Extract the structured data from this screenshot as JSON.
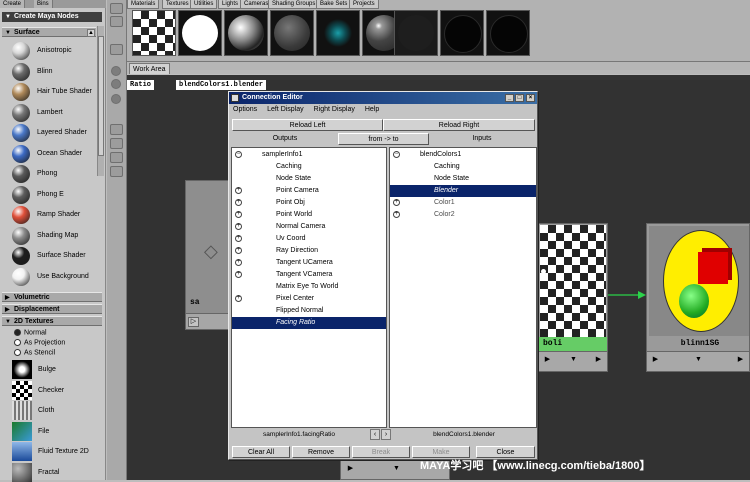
{
  "create_panel": {
    "top_tabs": [
      "Create",
      "Bins"
    ],
    "title": "Create Maya Nodes",
    "surface_header": "Surface",
    "shaders": [
      {
        "label": "Anisotropic",
        "icon": "anisotropic-shader-icon",
        "color": "#d7d7d7"
      },
      {
        "label": "Blinn",
        "icon": "blinn-shader-icon",
        "color": "#6b6b6b"
      },
      {
        "label": "Hair Tube Shader",
        "icon": "hair-tube-shader-icon",
        "color": "#b08a5a"
      },
      {
        "label": "Lambert",
        "icon": "lambert-shader-icon",
        "color": "#777777"
      },
      {
        "label": "Layered Shader",
        "icon": "layered-shader-icon",
        "color": "#4a78c8"
      },
      {
        "label": "Ocean Shader",
        "icon": "ocean-shader-icon",
        "color": "#3c6ac4"
      },
      {
        "label": "Phong",
        "icon": "phong-shader-icon",
        "color": "#5a5a5a"
      },
      {
        "label": "Phong E",
        "icon": "phong-e-shader-icon",
        "color": "#5e5e5e"
      },
      {
        "label": "Ramp Shader",
        "icon": "ramp-shader-icon",
        "color": "#e0503a"
      },
      {
        "label": "Shading Map",
        "icon": "shading-map-icon",
        "color": "#8c8c8c"
      },
      {
        "label": "Surface Shader",
        "icon": "surface-shader-icon",
        "color": "#1e1e1e"
      },
      {
        "label": "Use Background",
        "icon": "use-background-icon",
        "color": "#f2f2f2"
      }
    ],
    "sections": [
      "Volumetric",
      "Displacement",
      "2D Textures"
    ],
    "radio_options": [
      {
        "label": "Normal",
        "selected": true
      },
      {
        "label": "As Projection",
        "selected": false
      },
      {
        "label": "As Stencil",
        "selected": false
      }
    ],
    "textures": [
      {
        "label": "Bulge",
        "icon": "bulge-texture-icon"
      },
      {
        "label": "Checker",
        "icon": "checker-texture-icon"
      },
      {
        "label": "Cloth",
        "icon": "cloth-texture-icon"
      },
      {
        "label": "File",
        "icon": "file-texture-icon"
      },
      {
        "label": "Fluid Texture 2D",
        "icon": "fluid-texture-2d-icon"
      },
      {
        "label": "Fractal",
        "icon": "fractal-texture-icon"
      }
    ]
  },
  "hypershade": {
    "top_tabs": [
      "Materials",
      "Textures",
      "Utilities",
      "Lights",
      "Cameras",
      "Shading Groups",
      "Bake Sets",
      "Projects"
    ],
    "work_area_tab": "Work Area",
    "path_left": "Ratio",
    "path_right": "blendColors1.blender",
    "nodes": {
      "left_label": "sa",
      "checker_label": "boli",
      "sg_label": "blinn1SG"
    }
  },
  "connection_editor": {
    "title": "Connection Editor",
    "menu": [
      "Options",
      "Left Display",
      "Right Display",
      "Help"
    ],
    "reload_left": "Reload Left",
    "reload_right": "Reload Right",
    "outputs": "Outputs",
    "direction": "from -> to",
    "inputs": "Inputs",
    "left_list": [
      {
        "text": "samplerInfo1",
        "expander": "minus",
        "indent": 0
      },
      {
        "text": "Caching",
        "expander": "",
        "indent": 1
      },
      {
        "text": "Node State",
        "expander": "",
        "indent": 1
      },
      {
        "text": "Point Camera",
        "expander": "plus",
        "indent": 1
      },
      {
        "text": "Point Obj",
        "expander": "plus",
        "indent": 1
      },
      {
        "text": "Point World",
        "expander": "plus",
        "indent": 1
      },
      {
        "text": "Normal Camera",
        "expander": "plus",
        "indent": 1
      },
      {
        "text": "Uv Coord",
        "expander": "plus",
        "indent": 1
      },
      {
        "text": "Ray Direction",
        "expander": "plus",
        "indent": 1
      },
      {
        "text": "Tangent UCamera",
        "expander": "plus",
        "indent": 1
      },
      {
        "text": "Tangent VCamera",
        "expander": "plus",
        "indent": 1
      },
      {
        "text": "Matrix Eye To World",
        "expander": "",
        "indent": 1
      },
      {
        "text": "Pixel Center",
        "expander": "plus",
        "indent": 1
      },
      {
        "text": "Flipped Normal",
        "expander": "",
        "indent": 1
      },
      {
        "text": "Facing Ratio",
        "expander": "",
        "indent": 1,
        "selected": true
      }
    ],
    "right_list": [
      {
        "text": "blendColors1",
        "expander": "minus",
        "indent": 0
      },
      {
        "text": "Caching",
        "expander": "",
        "indent": 1
      },
      {
        "text": "Node State",
        "expander": "",
        "indent": 1
      },
      {
        "text": "Blender",
        "expander": "",
        "indent": 1,
        "selected": true
      },
      {
        "text": "Color1",
        "expander": "plus",
        "indent": 1,
        "dim": true
      },
      {
        "text": "Color2",
        "expander": "plus",
        "indent": 1,
        "dim": true
      }
    ],
    "left_status": "samplerInfo1.facingRatio",
    "right_status": "blendColors1.blender",
    "buttons": {
      "clear_all": "Clear All",
      "remove": "Remove",
      "break": "Break",
      "make": "Make",
      "close": "Close"
    }
  },
  "watermark": "MAYA学习吧 【www.linecg.com/tieba/1800】",
  "colors": {
    "title_bar_start": "#0a246a",
    "title_bar_end": "#3a6ea5",
    "selection": "#0a246a",
    "work_area_bg": "#323232",
    "sg_sphere_bg": "#ffee00",
    "connection_line": "#2bd24a",
    "checker_label_bg": "#66cc66"
  }
}
